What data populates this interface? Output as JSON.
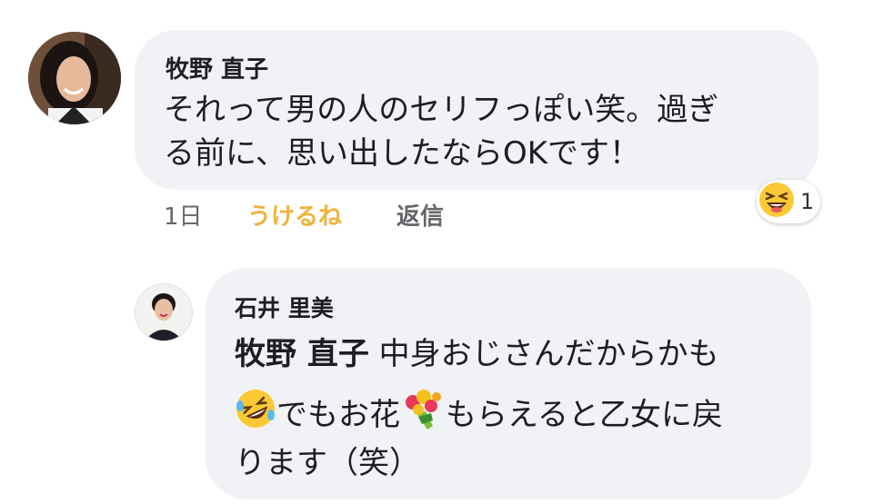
{
  "comment1": {
    "author": "牧野 直子",
    "text_line1": "それって男の人のセリフっぽい笑。過ぎ",
    "text_line2": "る前に、思い出したならOKです！",
    "time": "1日",
    "like_label": "うけるね",
    "reply_label": "返信",
    "reaction_count": "1",
    "reaction_icon": "laughing-face-emoji"
  },
  "comment2": {
    "author": "石井 里美",
    "mention": "牧野 直子",
    "text_line1_rest": "中身おじさんだからかも",
    "text_line2_a": "でもお花",
    "text_line2_b": "もらえると乙女に戻",
    "text_line3": "ります（笑）",
    "emoji_1": "rofl-emoji",
    "emoji_2": "bouquet-emoji"
  }
}
